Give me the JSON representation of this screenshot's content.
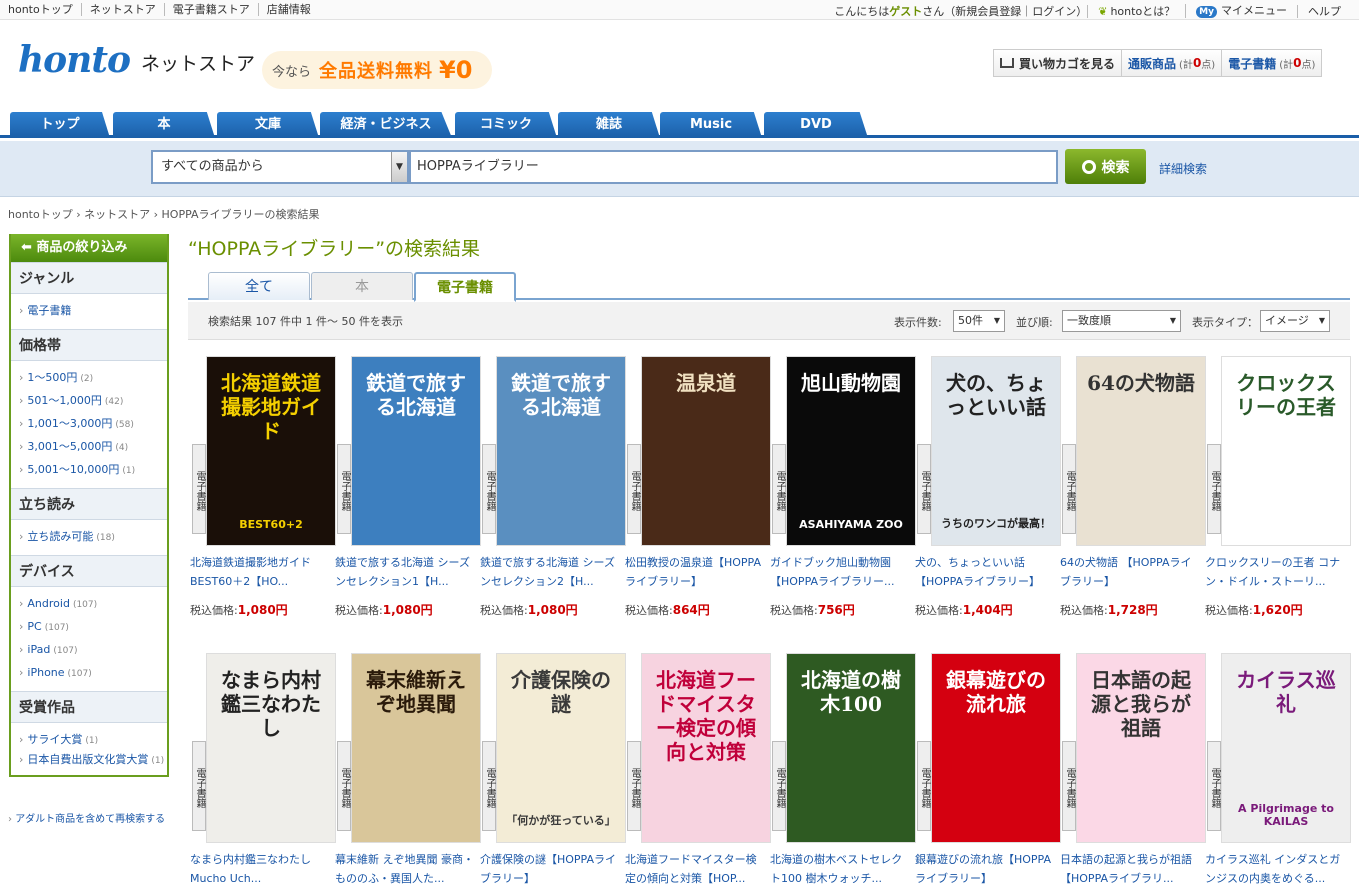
{
  "topbar": {
    "links": [
      "hontoトップ",
      "ネットストア",
      "電子書籍ストア",
      "店舗情報"
    ],
    "greeting_pre": "こんにちは",
    "greeting_name": "ゲスト",
    "greeting_post": "さん（",
    "register": "新規会員登録",
    "login": "ログイン",
    "greeting_end": "）",
    "about": "hontoとは？",
    "my_badge": "My",
    "mymenu": "マイメニュー",
    "help": "ヘルプ"
  },
  "header": {
    "logo": "honto",
    "logo_sub": "ネットストア",
    "ship_a": "今なら",
    "ship_b": "全品送料無料",
    "ship_c": "¥0",
    "cart": "買い物カゴを見る",
    "mail_label": "通販商品",
    "mail_count_pre": "(計",
    "mail_count": "0",
    "mail_count_post": "点)",
    "ebook_label": "電子書籍",
    "ebook_count_pre": "(計",
    "ebook_count": "0",
    "ebook_count_post": "点)"
  },
  "nav": [
    "トップ",
    "本",
    "文庫",
    "経済・ビジネス",
    "コミック",
    "雑誌",
    "Music",
    "DVD"
  ],
  "search": {
    "category": "すべての商品から",
    "query": "HOPPAライブラリー",
    "button": "検索",
    "advanced": "詳細検索"
  },
  "breadcrumb": [
    "hontoトップ",
    "ネットストア",
    "HOPPAライブラリーの検索結果"
  ],
  "sidebar": {
    "title": "商品の絞り込み",
    "sections": [
      {
        "title": "ジャンル",
        "items": [
          {
            "label": "電子書籍",
            "count": ""
          }
        ]
      },
      {
        "title": "価格帯",
        "items": [
          {
            "label": "1〜500円",
            "count": "(2)"
          },
          {
            "label": "501〜1,000円",
            "count": "(42)"
          },
          {
            "label": "1,001〜3,000円",
            "count": "(58)"
          },
          {
            "label": "3,001〜5,000円",
            "count": "(4)"
          },
          {
            "label": "5,001〜10,000円",
            "count": "(1)"
          }
        ]
      },
      {
        "title": "立ち読み",
        "items": [
          {
            "label": "立ち読み可能",
            "count": "(18)"
          }
        ]
      },
      {
        "title": "デバイス",
        "items": [
          {
            "label": "Android",
            "count": "(107)"
          },
          {
            "label": "PC",
            "count": "(107)"
          },
          {
            "label": "iPad",
            "count": "(107)"
          },
          {
            "label": "iPhone",
            "count": "(107)"
          }
        ]
      },
      {
        "title": "受賞作品",
        "items": [
          {
            "label": "サライ大賞",
            "count": "(1)"
          },
          {
            "label": "日本自費出版文化賞大賞",
            "count": "(1)"
          }
        ]
      }
    ],
    "adult": "アダルト商品を含めて再検索する"
  },
  "results": {
    "title": "“HOPPAライブラリー”の検索結果",
    "tabs": [
      "全て",
      "本",
      "電子書籍"
    ],
    "count_text": "検索結果 107 件中 1 件〜 50 件を表示",
    "per_page_label": "表示件数:",
    "per_page": "50件",
    "sort_label": "並び順:",
    "sort": "一致度順",
    "view_label": "表示タイプ：",
    "view": "イメージ",
    "badge": "電子書籍",
    "price_label": "税込価格:",
    "books": [
      {
        "title": "北海道鉄道撮影地ガイド BEST60＋2【HO...",
        "price": "1,080円",
        "cover_text": "北海道鉄道撮影地ガイド",
        "cover_sub": "BEST60+2",
        "bg": "#1a0f08",
        "fg": "#f5d000"
      },
      {
        "title": "鉄道で旅する北海道 シーズンセレクション1【H...",
        "price": "1,080円",
        "cover_text": "鉄道で旅する北海道",
        "cover_sub": "",
        "bg": "#3d7fbf",
        "fg": "#ffffff"
      },
      {
        "title": "鉄道で旅する北海道 シーズンセレクション2【H...",
        "price": "1,080円",
        "cover_text": "鉄道で旅する北海道",
        "cover_sub": "",
        "bg": "#5a8fc0",
        "fg": "#ffffff"
      },
      {
        "title": "松田教授の温泉道【HOPPAライブラリー】",
        "price": "864円",
        "cover_text": "温泉道",
        "cover_sub": "",
        "bg": "#4a2a18",
        "fg": "#f0e0c0"
      },
      {
        "title": "ガイドブック旭山動物園【HOPPAライブラリー...",
        "price": "756円",
        "cover_text": "旭山動物園",
        "cover_sub": "ASAHIYAMA ZOO",
        "bg": "#0a0a0a",
        "fg": "#ffffff"
      },
      {
        "title": "犬の、ちょっといい話【HOPPAライブラリー】",
        "price": "1,404円",
        "cover_text": "犬の、ちょっといい話",
        "cover_sub": "うちのワンコが最高！",
        "bg": "#dfe6ec",
        "fg": "#222222"
      },
      {
        "title": "64の犬物語 【HOPPAライブラリー】",
        "price": "1,728円",
        "cover_text": "64の犬物語",
        "cover_sub": "",
        "bg": "#e9e1d2",
        "fg": "#333333"
      },
      {
        "title": "クロックスリーの王者 コナン・ドイル・ストーリ...",
        "price": "1,620円",
        "cover_text": "クロックスリーの王者",
        "cover_sub": "",
        "bg": "#ffffff",
        "fg": "#2a5a2a"
      },
      {
        "title": "なまら内村鑑三なわたし Mucho Uch...",
        "price": "",
        "cover_text": "なまら内村鑑三なわたし",
        "cover_sub": "",
        "bg": "#efeeea",
        "fg": "#222222"
      },
      {
        "title": "幕末維新 えぞ地異聞 豪商・もののふ・異国人た...",
        "price": "",
        "cover_text": "幕末維新えぞ地異聞",
        "cover_sub": "",
        "bg": "#d9c69a",
        "fg": "#2a1a0a"
      },
      {
        "title": "介護保険の謎【HOPPAライブラリー】",
        "price": "",
        "cover_text": "介護保険の謎",
        "cover_sub": "「何かが狂っている」",
        "bg": "#f3ecd6",
        "fg": "#3a3a3a"
      },
      {
        "title": "北海道フードマイスター検定の傾向と対策【HOP...",
        "price": "",
        "cover_text": "北海道フードマイスター検定の傾向と対策",
        "cover_sub": "",
        "bg": "#f7d3e0",
        "fg": "#c0003a"
      },
      {
        "title": "北海道の樹木ベストセレクト100 樹木ウォッチ...",
        "price": "",
        "cover_text": "北海道の樹木100",
        "cover_sub": "",
        "bg": "#2e5a22",
        "fg": "#ffffff"
      },
      {
        "title": "銀幕遊びの流れ旅【HOPPAライブラリー】",
        "price": "",
        "cover_text": "銀幕遊びの流れ旅",
        "cover_sub": "",
        "bg": "#d40010",
        "fg": "#ffffff"
      },
      {
        "title": "日本語の起源と我らが祖語【HOPPAライブラリ...",
        "price": "",
        "cover_text": "日本語の起源と我らが祖語",
        "cover_sub": "",
        "bg": "#fbd8e6",
        "fg": "#333333"
      },
      {
        "title": "カイラス巡礼 インダスとガンジスの内奥をめぐる...",
        "price": "",
        "cover_text": "カイラス巡礼",
        "cover_sub": "A Pilgrimage to KAILAS",
        "bg": "#eeeeee",
        "fg": "#7a1a7a"
      }
    ]
  }
}
